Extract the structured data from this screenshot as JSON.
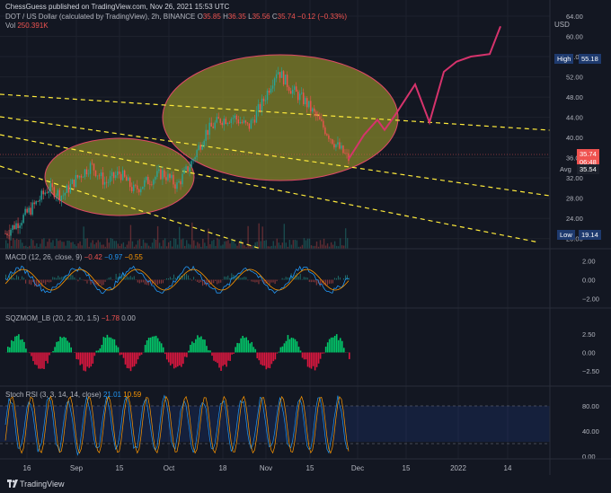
{
  "header": {
    "published": "ChessGuess published on TradingView.com, Nov 26, 2021 15:53 UTC"
  },
  "legend": {
    "symbol": "DOT / US Dollar (calculated by TradingView), 2h, BINANCE",
    "o_label": "O",
    "o_val": "35.85",
    "h_label": "H",
    "h_val": "36.35",
    "l_label": "L",
    "l_val": "35.56",
    "c_label": "C",
    "c_val": "35.74",
    "change": "−0.12 (−0.33%)",
    "vol_label": "Vol",
    "vol_val": "250.391K"
  },
  "colors": {
    "bg": "#131722",
    "grid": "#1e222d",
    "up": "#26a69a",
    "down": "#ef5350",
    "projection": "#d6336c",
    "trendline": "#ffeb3b",
    "ellipse_fill": "#8b8b2a"
  },
  "price_axis": {
    "currency": "USD",
    "ticks": [
      "64.00",
      "60.00",
      "56.00",
      "52.00",
      "48.00",
      "44.00",
      "40.00",
      "36.00",
      "32.00",
      "28.00",
      "24.00",
      "20.00"
    ],
    "high_label": "High",
    "high_val": "55.18",
    "last_val": "35.74",
    "countdown": "06:48",
    "avg_label": "Avg",
    "avg_val": "35.54",
    "low_label": "Low",
    "low_val": "19.14"
  },
  "macd": {
    "title": "MACD (12, 26, close, 9)",
    "v1": "−0.42",
    "v2": "−0.97",
    "v3": "−0.55",
    "ticks": [
      "2.00",
      "0.00",
      "−2.00"
    ]
  },
  "sqz": {
    "title": "SQZMOM_LB (20, 2, 20, 1.5)",
    "v1": "−1.78",
    "v2": "0.00",
    "ticks": [
      "2.50",
      "0.00",
      "−2.50"
    ]
  },
  "stoch": {
    "title": "Stoch RSI (3, 3, 14, 14, close)",
    "k": "21.01",
    "d": "10.59",
    "ticks": [
      "80.00",
      "40.00",
      "0.00"
    ]
  },
  "time_axis": [
    "16",
    "Sep",
    "15",
    "Oct",
    "18",
    "Nov",
    "15",
    "Dec",
    "15",
    "2022",
    "14"
  ],
  "footer": {
    "brand": "TradingView"
  },
  "chart_data": {
    "type": "line",
    "symbol": "DOT / US Dollar",
    "interval": "2h",
    "price_scale": {
      "min": 18,
      "max": 64
    },
    "x": [
      "16",
      "Sep",
      "15",
      "Oct",
      "18",
      "Nov",
      "15",
      "Dec",
      "15",
      "2022",
      "14"
    ],
    "series": [
      {
        "values": [
          21.0,
          23.5,
          26.5,
          30.0,
          28.5,
          32.0,
          34.5,
          31.0,
          33.0,
          29.5,
          31.5,
          33.0,
          30.5,
          35.0,
          41.0,
          43.5,
          44.0,
          42.0,
          47.0,
          53.5,
          49.5,
          47.0,
          43.0,
          39.0,
          35.74
        ]
      },
      {
        "values": [
          35.74,
          40.5,
          43.5,
          41.5,
          44.5,
          50.5,
          43.0,
          53.0,
          55.0,
          56.0,
          56.5,
          62.0
        ]
      }
    ],
    "reference_values": {
      "high": 55.18,
      "avg": 35.54,
      "low": 19.14
    },
    "macd_range": [
      -3,
      3
    ],
    "sqz_range": [
      -4,
      4
    ],
    "stoch_range": [
      0,
      100
    ]
  }
}
